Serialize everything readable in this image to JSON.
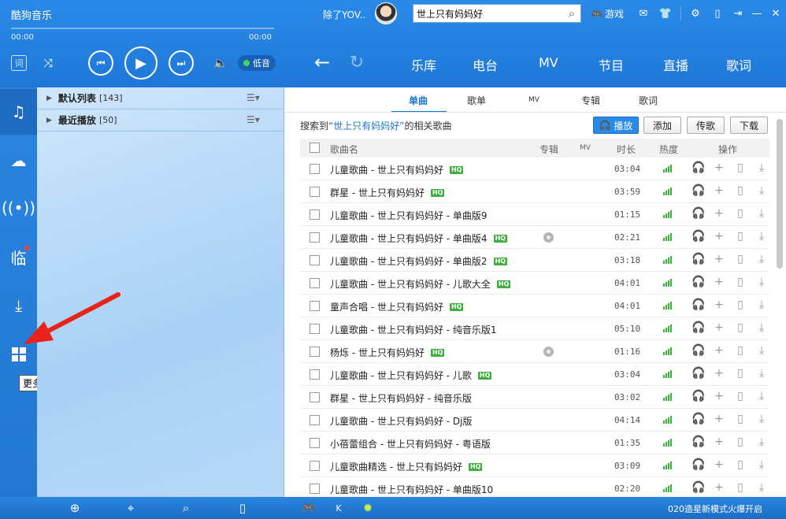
{
  "app": {
    "title": "酷狗音乐"
  },
  "player": {
    "time_current": "00:00",
    "time_total": "00:00",
    "lyric_label": "词",
    "quality_label": "低音"
  },
  "nav": {
    "tabs": [
      "乐库",
      "电台",
      "MV",
      "节目",
      "直播",
      "歌词"
    ]
  },
  "user": {
    "name": "除了YOV.."
  },
  "search": {
    "value": "世上只有妈妈好"
  },
  "toolbar": {
    "game_label": "游戏"
  },
  "rail": {
    "tooltip": "更多"
  },
  "playlists": [
    {
      "name": "默认列表",
      "count": "[143]"
    },
    {
      "name": "最近播放",
      "count": "[50]"
    }
  ],
  "results": {
    "subtabs": [
      "单曲",
      "歌单",
      "MV",
      "专辑",
      "歌词"
    ],
    "prefix": "搜索到",
    "keyword": "“世上只有妈妈好”",
    "suffix": "的相关歌曲",
    "buttons": {
      "play": "播放",
      "add": "添加",
      "send": "传歌",
      "download": "下载"
    },
    "headers": {
      "name": "歌曲名",
      "album": "专辑",
      "mv": "MV",
      "duration": "时长",
      "heat": "热度",
      "ops": "操作"
    },
    "rows": [
      {
        "title": "儿童歌曲 - 世上只有妈妈好",
        "hq": true,
        "album": false,
        "duration": "03:04"
      },
      {
        "title": "群星 - 世上只有妈妈好",
        "hq": true,
        "album": false,
        "duration": "03:59"
      },
      {
        "title": "儿童歌曲 - 世上只有妈妈好 - 单曲版9",
        "hq": false,
        "album": false,
        "duration": "01:15"
      },
      {
        "title": "儿童歌曲 - 世上只有妈妈好 - 单曲版4",
        "hq": true,
        "album": true,
        "duration": "02:21"
      },
      {
        "title": "儿童歌曲 - 世上只有妈妈好 - 单曲版2",
        "hq": true,
        "album": false,
        "duration": "03:18"
      },
      {
        "title": "儿童歌曲 - 世上只有妈妈好 - 儿歌大全",
        "hq": true,
        "album": false,
        "duration": "04:01"
      },
      {
        "title": "童声合唱 - 世上只有妈妈好",
        "hq": true,
        "album": false,
        "duration": "04:01"
      },
      {
        "title": "儿童歌曲 - 世上只有妈妈好 - 纯音乐版1",
        "hq": false,
        "album": false,
        "duration": "05:10"
      },
      {
        "title": "杨烁 - 世上只有妈妈好",
        "hq": true,
        "album": true,
        "duration": "01:16"
      },
      {
        "title": "儿童歌曲 - 世上只有妈妈好 - 儿歌",
        "hq": true,
        "album": false,
        "duration": "03:04"
      },
      {
        "title": "群星 - 世上只有妈妈好 - 纯音乐版",
        "hq": false,
        "album": false,
        "duration": "03:02"
      },
      {
        "title": "儿童歌曲 - 世上只有妈妈好 - Dj版",
        "hq": false,
        "album": false,
        "duration": "04:14"
      },
      {
        "title": "小蓓蕾组合 - 世上只有妈妈好 - 粤语版",
        "hq": false,
        "album": false,
        "duration": "01:35"
      },
      {
        "title": "儿童歌曲精选 - 世上只有妈妈好",
        "hq": true,
        "album": false,
        "duration": "03:09"
      },
      {
        "title": "儿童歌曲 - 世上只有妈妈好 - 单曲版10",
        "hq": false,
        "album": false,
        "duration": "02:20"
      }
    ]
  },
  "bottom": {
    "news": "020造星新模式火爆开启"
  },
  "colors": {
    "accent": "#2a8ae8",
    "heat": "#3db23d",
    "hq": "#3fae3f",
    "annotation": "#e8231a"
  }
}
